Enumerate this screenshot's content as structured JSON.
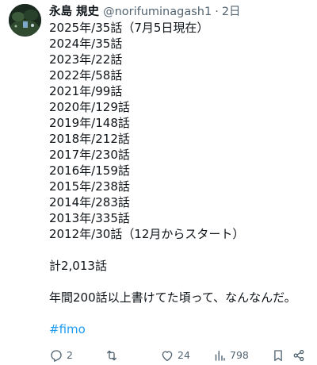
{
  "post": {
    "author_name": "永島 規史",
    "handle": "@norifuminagash1",
    "separator": "·",
    "time": "2日",
    "lines": [
      "2025年/35話（7月5日現在）",
      "2024年/35話",
      "2023年/22話",
      "2022年/58話",
      "2021年/99話",
      "2020年/129話",
      "2019年/148話",
      "2018年/212話",
      "2017年/230話",
      "2016年/159話",
      "2015年/238話",
      "2014年/283話",
      "2013年/335話",
      "2012年/30話（12月からスタート）"
    ],
    "total": "計2,013話",
    "comment": "年間200話以上書けてた頃って、なんなんだ。",
    "hashtag": "#fimo"
  },
  "actions": {
    "reply": {
      "icon": "reply-icon",
      "count": "2"
    },
    "repost": {
      "icon": "repost-icon",
      "count": ""
    },
    "like": {
      "icon": "heart-icon",
      "count": "24"
    },
    "views": {
      "icon": "views-icon",
      "count": "798"
    },
    "bookmark": {
      "icon": "bookmark-icon"
    },
    "share": {
      "icon": "share-icon"
    }
  },
  "colors": {
    "text": "#0f1419",
    "secondary": "#536471",
    "link": "#1d9bf0"
  }
}
